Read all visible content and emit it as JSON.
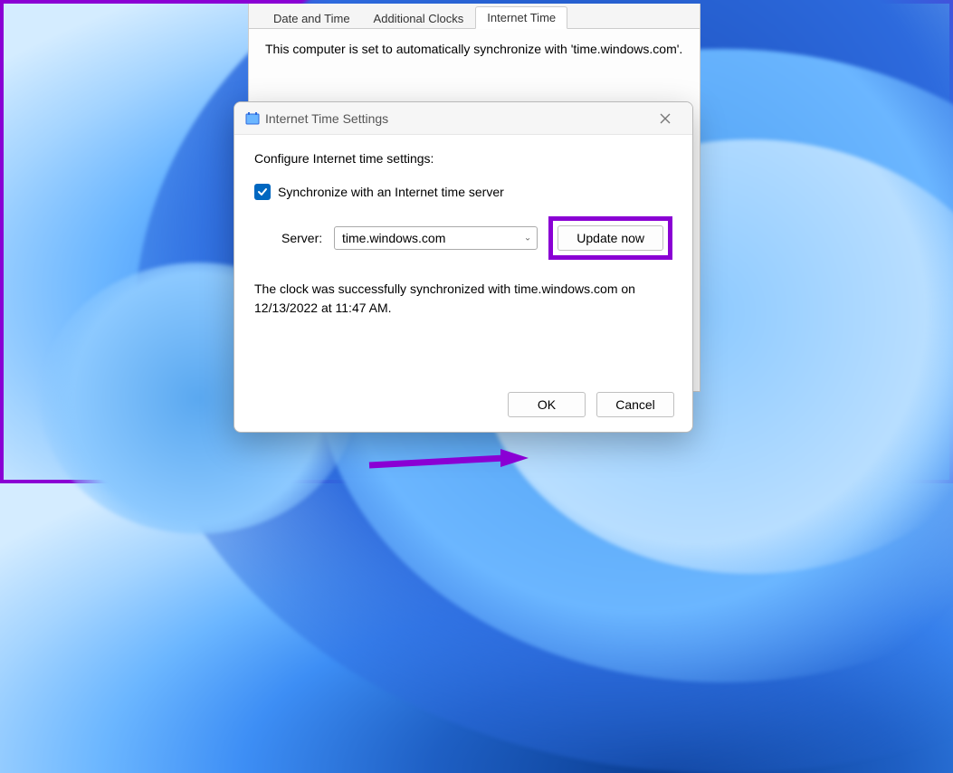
{
  "parent": {
    "tabs": [
      "Date and Time",
      "Additional Clocks",
      "Internet Time"
    ],
    "active_tab_index": 2,
    "sync_text": "This computer is set to automatically synchronize with 'time.windows.com'."
  },
  "dialog": {
    "title": "Internet Time Settings",
    "configure_label": "Configure Internet time settings:",
    "sync_checkbox_label": "Synchronize with an Internet time server",
    "sync_checked": true,
    "server_label": "Server:",
    "server_value": "time.windows.com",
    "update_button": "Update now",
    "status_text": "The clock was successfully synchronized with time.windows.com on 12/13/2022 at 11:47 AM.",
    "ok_button": "OK",
    "cancel_button": "Cancel"
  },
  "colors": {
    "highlight": "#8a00d4",
    "accent": "#0067c0"
  }
}
